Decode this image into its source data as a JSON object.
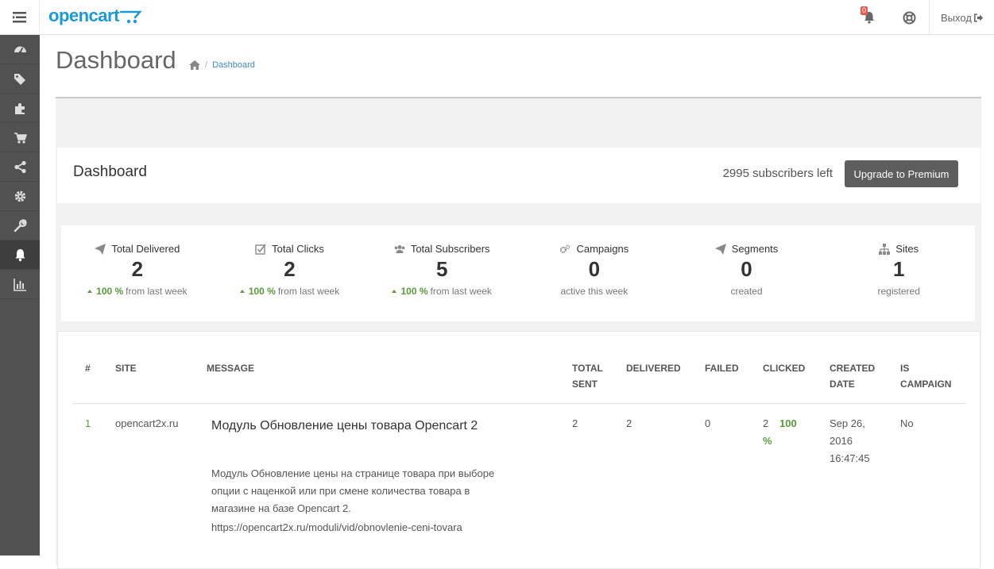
{
  "header": {
    "logo_text": "opencart",
    "notification_count": "0",
    "logout_label": "Выход"
  },
  "sidebar": {
    "items": [
      {
        "icon": "dashboard-icon"
      },
      {
        "icon": "tags-icon"
      },
      {
        "icon": "puzzle-icon"
      },
      {
        "icon": "cart-icon"
      },
      {
        "icon": "share-icon"
      },
      {
        "icon": "gear-icon"
      },
      {
        "icon": "wrench-icon"
      },
      {
        "icon": "bell-icon",
        "active": true
      },
      {
        "icon": "bar-chart-icon"
      }
    ]
  },
  "page": {
    "title": "Dashboard",
    "breadcrumb": [
      "Dashboard"
    ]
  },
  "dashboard": {
    "title": "Dashboard",
    "subscribers_left": "2995 subscribers left",
    "upgrade_label": "Upgrade to Premium"
  },
  "stats": [
    {
      "label": "Total Delivered",
      "value": "2",
      "pct": "100 %",
      "sub": "from last week"
    },
    {
      "label": "Total Clicks",
      "value": "2",
      "pct": "100 %",
      "sub": "from last week"
    },
    {
      "label": "Total Subscribers",
      "value": "5",
      "pct": "100 %",
      "sub": "from last week"
    },
    {
      "label": "Campaigns",
      "value": "0",
      "sub": "active this week"
    },
    {
      "label": "Segments",
      "value": "0",
      "sub": "created"
    },
    {
      "label": "Sites",
      "value": "1",
      "sub": "registered"
    }
  ],
  "table": {
    "headers": {
      "num": "#",
      "site": "SITE",
      "message": "MESSAGE",
      "total_sent_1": "TOTAL",
      "total_sent_2": "SENT",
      "delivered": "DELIVERED",
      "failed": "FAILED",
      "clicked": "CLICKED",
      "created_1": "CREATED",
      "created_2": "DATE",
      "campaign_1": "IS",
      "campaign_2": "CAMPAIGN"
    },
    "rows": [
      {
        "num": "1",
        "site": "opencart2x.ru",
        "message_title": "Модуль Обновление цены товара Opencart 2",
        "message_body": "Модуль Обновление цены на странице товара при выборе опции с наценкой или при смене количества товара в магазине на базе Opencart 2.",
        "message_url": "https://opencart2x.ru/moduli/vid/obnovlenie-ceni-tovara",
        "total_sent": "2",
        "delivered": "2",
        "failed": "0",
        "clicked": "2",
        "clicked_pct": "100",
        "clicked_pct_unit": "%",
        "created_1": "Sep 26,",
        "created_2": "2016",
        "created_3": "16:47:45",
        "is_campaign": "No"
      }
    ]
  },
  "colors": {
    "sidebar_bg": "#515151",
    "logo": "#1a9bd6",
    "button": "#5d5d5d",
    "positive": "#5a9a3a"
  }
}
